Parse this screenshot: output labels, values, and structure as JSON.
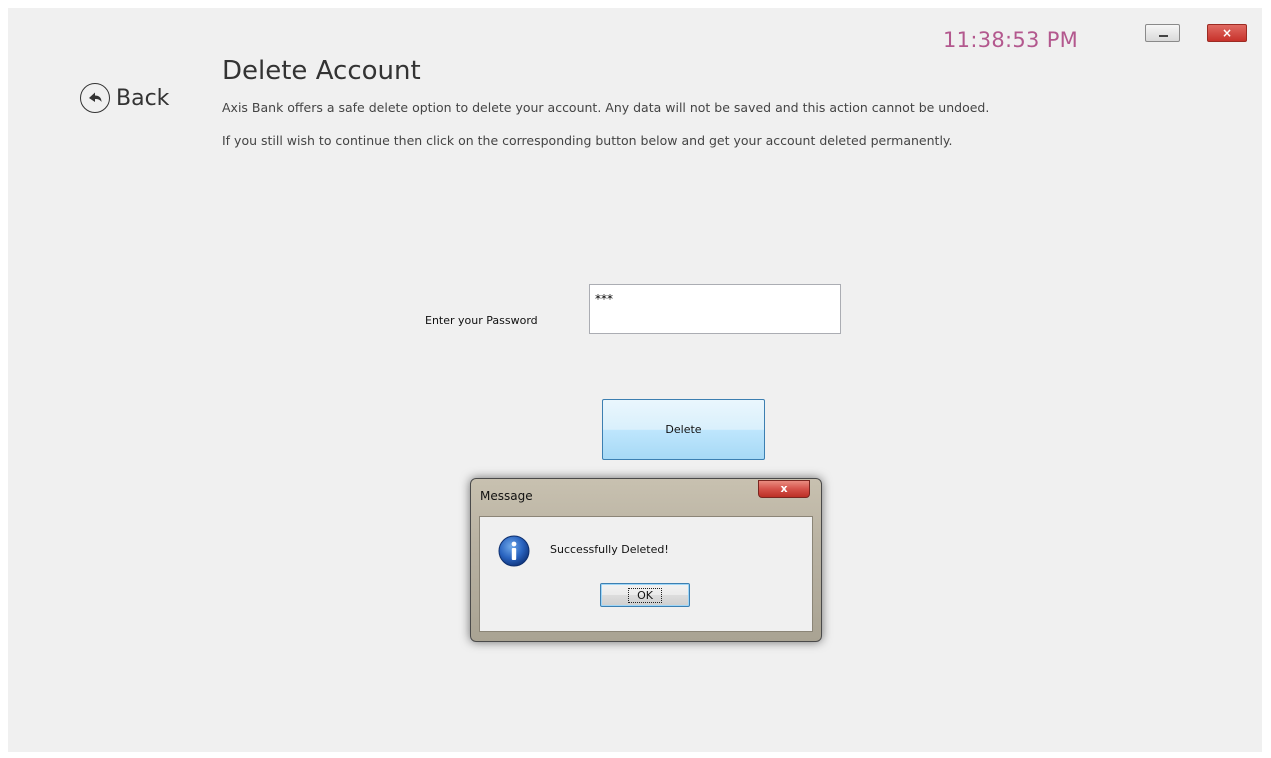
{
  "window": {
    "clock": "11:38:53 PM",
    "minimize_label": "_",
    "close_label": "×"
  },
  "nav": {
    "back_label": "Back"
  },
  "page": {
    "title": "Delete Account",
    "description_line1": "Axis Bank offers a safe delete option to delete your account. Any data will not be saved and this action cannot be undoed.",
    "description_line2": "If you still wish to continue then click on the corresponding button below and get your account deleted permanently."
  },
  "form": {
    "password_label": "Enter your Password",
    "password_value": "***",
    "delete_button": "Delete"
  },
  "dialog": {
    "title": "Message",
    "close_label": "x",
    "message": "Successfully Deleted!",
    "ok_button": "OK",
    "icon": "info-icon"
  },
  "colors": {
    "clock": "#b3588e",
    "window_bg": "#f0f0f0",
    "delete_button_bg": "#bee6fd",
    "close_red": "#c7322b"
  }
}
